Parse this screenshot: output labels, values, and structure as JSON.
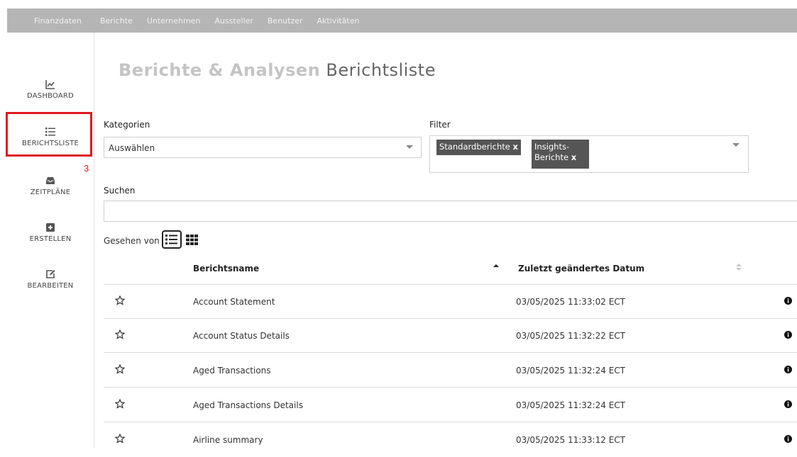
{
  "topnav": {
    "items": [
      "Finanzdaten",
      "Berichte",
      "Unternehmen",
      "Aussteller",
      "Benutzer",
      "Aktivitäten"
    ]
  },
  "sidebar": {
    "items": [
      {
        "label": "DASHBOARD",
        "icon": "chart-line-icon"
      },
      {
        "label": "BERICHTSLISTE",
        "icon": "list-icon"
      },
      {
        "label": "ZEITPLÄNE",
        "icon": "inbox-icon"
      },
      {
        "label": "ERSTELLEN",
        "icon": "plus-square-icon"
      },
      {
        "label": "BEARBEITEN",
        "icon": "edit-icon"
      }
    ],
    "annotation_number": "3",
    "highlight_color": "#e0191f"
  },
  "page": {
    "title_bold": "Berichte & Analysen",
    "title_light": "Berichtsliste"
  },
  "categories": {
    "label": "Kategorien",
    "value": "Auswählen"
  },
  "filter": {
    "label": "Filter",
    "tags": [
      {
        "text": "Standardberichte",
        "remove": "x"
      },
      {
        "text1": "Insights-",
        "text2": "Berichte",
        "remove": "x"
      }
    ]
  },
  "search": {
    "label": "Suchen",
    "value": ""
  },
  "view": {
    "label": "Gesehen von"
  },
  "table": {
    "col_name": "Berichtsname",
    "col_date": "Zuletzt geändertes Datum",
    "rows": [
      {
        "name": "Account Statement",
        "date": "03/05/2025 11:33:02 ECT"
      },
      {
        "name": "Account Status Details",
        "date": "03/05/2025 11:32:22 ECT"
      },
      {
        "name": "Aged Transactions",
        "date": "03/05/2025 11:32:24 ECT"
      },
      {
        "name": "Aged Transactions Details",
        "date": "03/05/2025 11:32:24 ECT"
      },
      {
        "name": "Airline summary",
        "date": "03/05/2025 11:33:12 ECT"
      }
    ]
  }
}
